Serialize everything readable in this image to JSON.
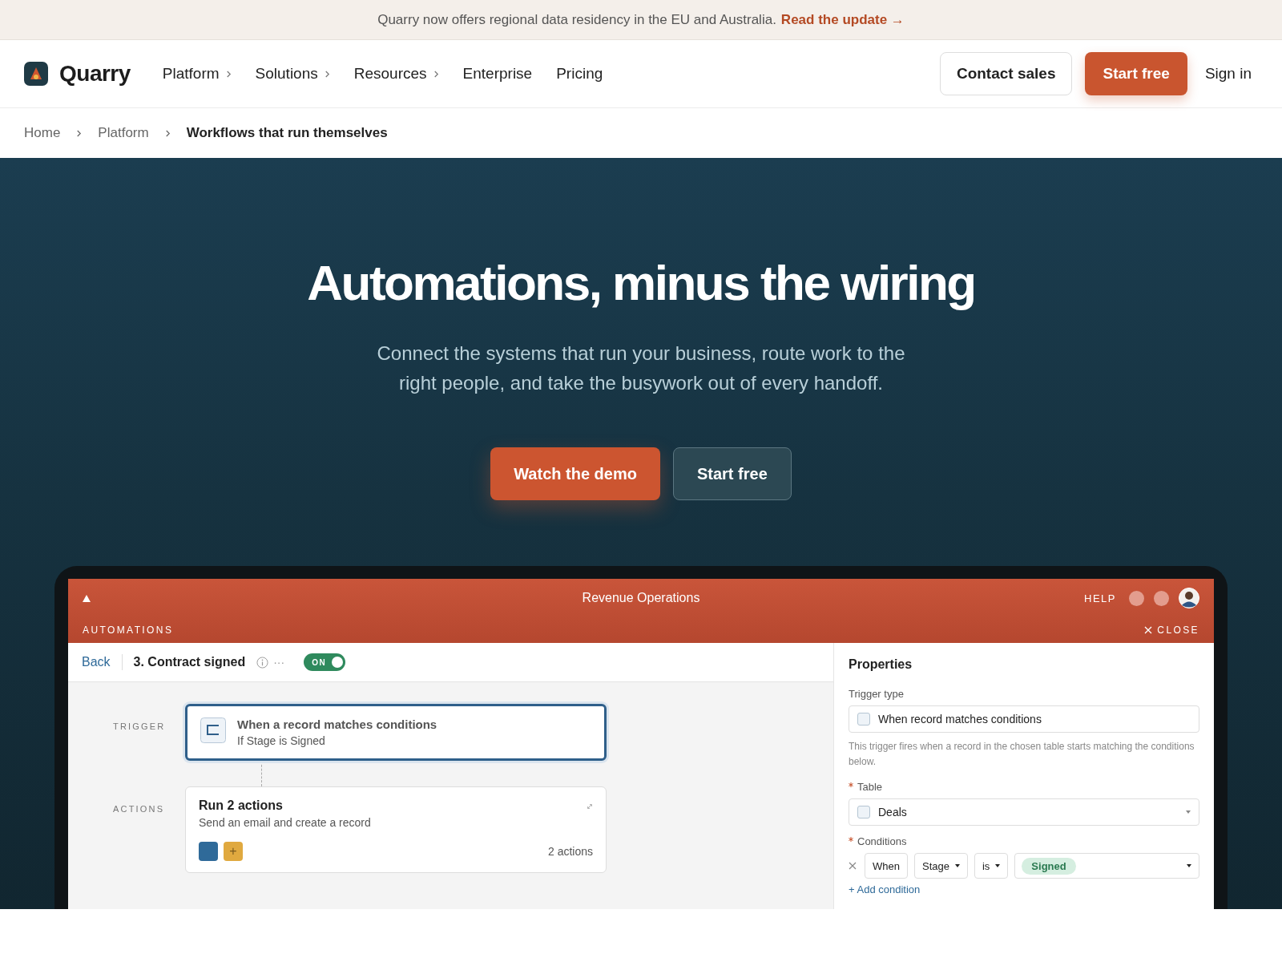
{
  "banner": {
    "text": "Quarry now offers regional data residency in the EU and Australia.",
    "link": "Read the update →"
  },
  "nav": {
    "brand": "Quarry",
    "items": [
      {
        "label": "Platform",
        "has_menu": true
      },
      {
        "label": "Solutions",
        "has_menu": true
      },
      {
        "label": "Resources",
        "has_menu": true
      },
      {
        "label": "Enterprise",
        "has_menu": false
      },
      {
        "label": "Pricing",
        "has_menu": false
      }
    ],
    "contact": "Contact sales",
    "start": "Start free",
    "signin": "Sign in"
  },
  "breadcrumb": [
    {
      "label": "Home",
      "current": false
    },
    {
      "label": "Platform",
      "current": false
    },
    {
      "label": "Workflows that run themselves",
      "current": true
    }
  ],
  "hero": {
    "title": "Automations, minus the wiring",
    "subtitle": "Connect the systems that run your business, route work to the right people, and take the busywork out of every handoff.",
    "primary": "Watch the demo",
    "secondary": "Start free"
  },
  "app": {
    "title": "Revenue Operations",
    "help": "HELP",
    "section": "AUTOMATIONS",
    "close": "CLOSE",
    "toolbar": {
      "back": "Back",
      "name": "3. Contract signed",
      "more": "···",
      "toggle": {
        "label": "ON",
        "on": true
      }
    },
    "trigger": {
      "label": "TRIGGER",
      "title": "When a record matches conditions",
      "subtitle": "If Stage is Signed",
      "selected": true
    },
    "actions": {
      "label": "ACTIONS",
      "title": "Run 2 actions",
      "subtitle": "Send an email and create a record",
      "count": "2 actions",
      "selected": false,
      "tiles": [
        {
          "kind": "plain",
          "color": "#2f6a99"
        },
        {
          "kind": "add",
          "text": "+",
          "color": "#e0a93f"
        }
      ]
    },
    "properties": {
      "title": "Properties",
      "trigger_type": {
        "label": "Trigger type",
        "value": "When record matches conditions"
      },
      "help": "This trigger fires when a record in the chosen table starts matching the conditions below.",
      "table": {
        "label": "Table",
        "required": true,
        "value": "Deals"
      },
      "conditions": {
        "label": "Conditions",
        "required": true,
        "when": "When",
        "field": "Stage",
        "operator": "is",
        "value": "Signed"
      },
      "add": "+ Add condition"
    }
  }
}
